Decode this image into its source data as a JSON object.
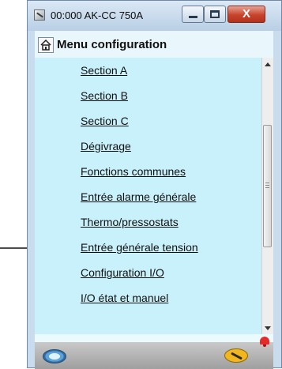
{
  "window": {
    "title": "00:000 AK-CC 750A",
    "close_symbol": "X"
  },
  "header": {
    "title": "Menu configuration"
  },
  "menu": {
    "items": [
      {
        "label": "Section A"
      },
      {
        "label": "Section B"
      },
      {
        "label": "Section C"
      },
      {
        "label": "Dégivrage"
      },
      {
        "label": "Fonctions communes"
      },
      {
        "label": "Entrée alarme générale"
      },
      {
        "label": "Thermo/pressostats"
      },
      {
        "label": "Entrée générale tension"
      },
      {
        "label": "Configuration I/O"
      },
      {
        "label": "I/O  état et manuel"
      }
    ]
  },
  "icons": {
    "app": "app-icon",
    "home": "home-icon",
    "device": "device-icon",
    "tool": "wrench-icon",
    "alarm": "alarm-bell-icon",
    "pointer": "arrow-icon"
  }
}
